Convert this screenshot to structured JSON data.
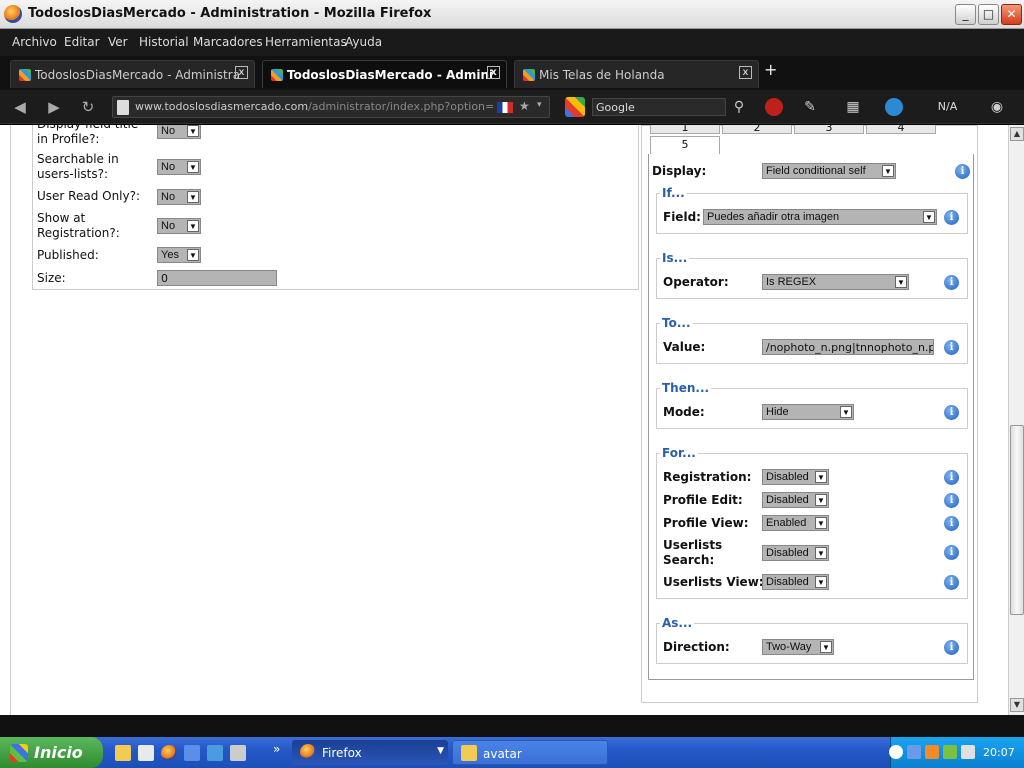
{
  "window": {
    "title": "TodoslosDiasMercado - Administration - Mozilla Firefox",
    "min": "_",
    "max": "□",
    "close": "✕"
  },
  "menu": [
    "Archivo",
    "Editar",
    "Ver",
    "Historial",
    "Marcadores",
    "Herramientas",
    "Ayuda"
  ],
  "tabs": [
    {
      "label": "TodoslosDiasMercado - Administration",
      "close": "x"
    },
    {
      "label": "TodoslosDiasMercado - Administ...",
      "close": "x"
    },
    {
      "label": "Mis Telas de Holanda",
      "close": "x"
    }
  ],
  "newtab": "+",
  "nav": {
    "back": "◀",
    "forward": "▶",
    "reload": "↻",
    "url_host": "www.todoslosdiasmercado.com",
    "url_path": "/administrator/index.php?option=com_com",
    "star": "★",
    "dropdown": "▾",
    "search_text": "Google",
    "search_icon": "⚲",
    "na_text": "N/A"
  },
  "left_form": {
    "rows": [
      {
        "label": "Display field title in Profile?:",
        "value": "No"
      },
      {
        "label": "Searchable in users-lists?:",
        "value": "No"
      },
      {
        "label": "User Read Only?:",
        "value": "No"
      },
      {
        "label": "Show at Registration?:",
        "value": "No"
      },
      {
        "label": "Published:",
        "value": "Yes"
      },
      {
        "label": "Size:",
        "value": "0"
      }
    ]
  },
  "right_panel": {
    "tabs": [
      "1",
      "2",
      "3",
      "4",
      "5"
    ],
    "display": {
      "label": "Display:",
      "value": "Field conditional self"
    },
    "if": {
      "legend": "If...",
      "label": "Field:",
      "value": "Puedes añadir otra imagen"
    },
    "is": {
      "legend": "Is...",
      "label": "Operator:",
      "value": "Is REGEX"
    },
    "to": {
      "legend": "To...",
      "label": "Value:",
      "value": "/nophoto_n.png|tnnophoto_n.png/"
    },
    "then": {
      "legend": "Then...",
      "label": "Mode:",
      "value": "Hide"
    },
    "for": {
      "legend": "For...",
      "rows": [
        {
          "label": "Registration:",
          "value": "Disabled"
        },
        {
          "label": "Profile Edit:",
          "value": "Disabled"
        },
        {
          "label": "Profile View:",
          "value": "Enabled"
        },
        {
          "label": "Userlists Search:",
          "value": "Disabled"
        },
        {
          "label": "Userlists View:",
          "value": "Disabled"
        }
      ]
    },
    "as": {
      "legend": "As...",
      "label": "Direction:",
      "value": "Two-Way"
    },
    "info_glyph": "i"
  },
  "taskbar": {
    "start": "Inicio",
    "more": "»",
    "tasks": [
      {
        "label": "Firefox"
      },
      {
        "label": "avatar"
      }
    ],
    "clock": "20:07"
  },
  "colors": {
    "legend": "#2a5faa",
    "select_bg": "#b4b4b4",
    "start_green": "#3ba23b",
    "taskbar_blue": "#2458c8"
  }
}
